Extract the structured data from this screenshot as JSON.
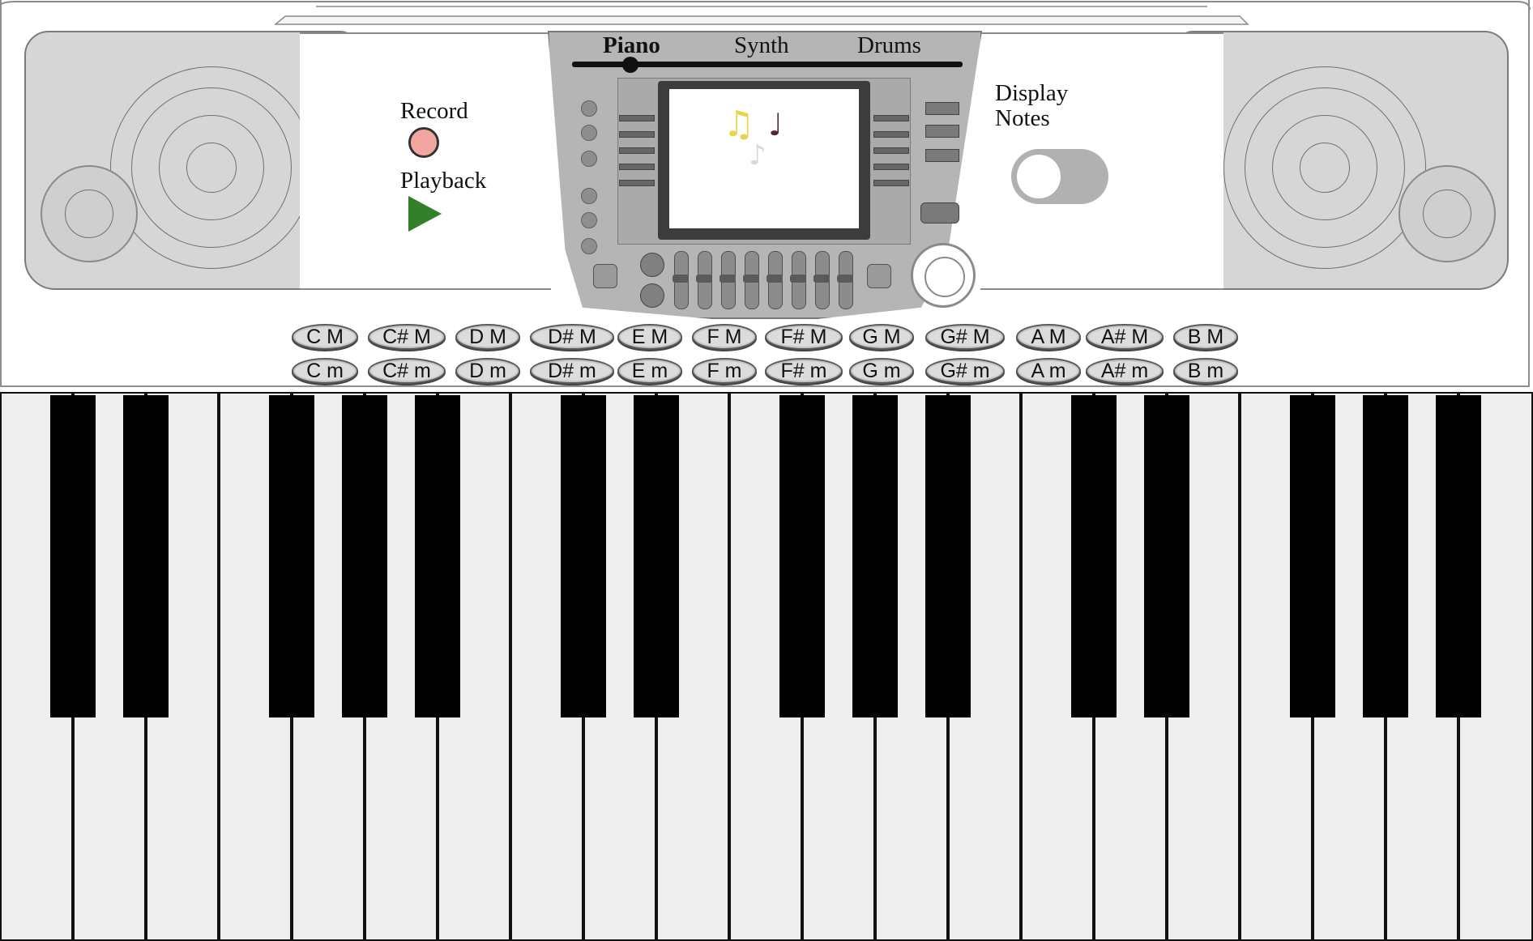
{
  "modes": {
    "items": [
      "Piano",
      "Synth",
      "Drums"
    ],
    "selected": "Piano"
  },
  "controls": {
    "record_label": "Record",
    "playback_label": "Playback",
    "display_notes_label_line1": "Display",
    "display_notes_label_line2": "Notes",
    "display_notes_on": false
  },
  "screen": {
    "notes": [
      "♫",
      "♩",
      "♪"
    ],
    "note_colors": [
      "#e8d44a",
      "#5a2430",
      "#d8d8d8"
    ]
  },
  "chords": {
    "major": [
      "C M",
      "C# M",
      "D M",
      "D# M",
      "E M",
      "F M",
      "F# M",
      "G M",
      "G# M",
      "A M",
      "A# M",
      "B M"
    ],
    "minor": [
      "C m",
      "C# m",
      "D m",
      "D# m",
      "E m",
      "F m",
      "F# m",
      "G m",
      "G# m",
      "A m",
      "A# m",
      "B m"
    ]
  },
  "piano": {
    "white_key_count": 21,
    "black_key_count": 15
  },
  "colors": {
    "record": "#f2a6a0",
    "playback": "#33802a",
    "toggle_track": "#b1b1b1",
    "white_key": "#eeeeee",
    "black_key": "#000000",
    "console": "#b5b5b5"
  }
}
